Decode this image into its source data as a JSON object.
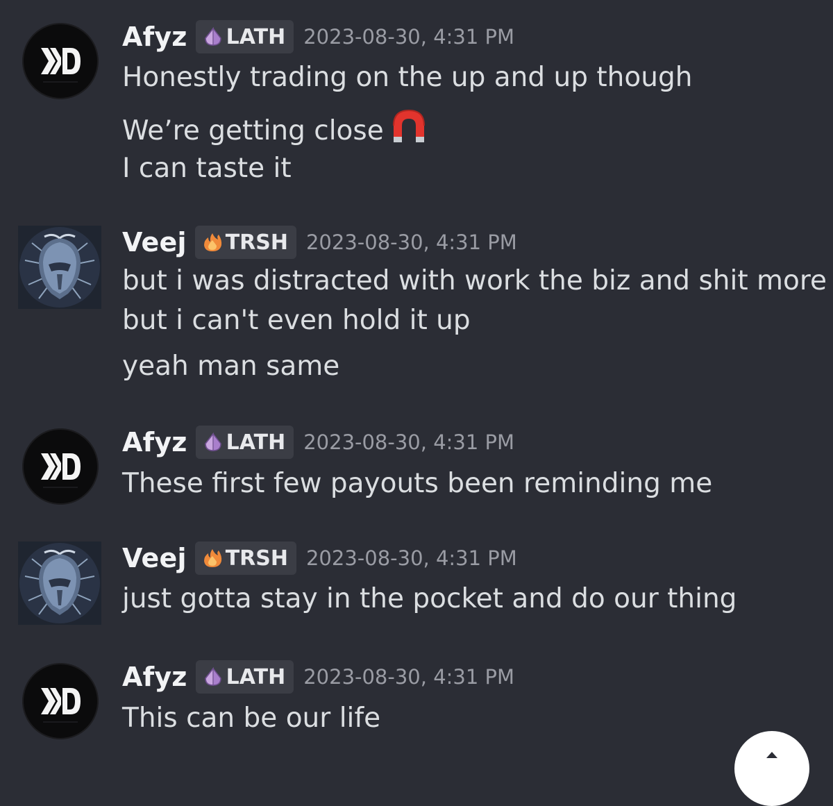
{
  "messages": [
    {
      "author": "Afyz",
      "role_tag": "LATH",
      "role_icon": "crystal-icon",
      "timestamp": "2023-08-30, 4:31 PM",
      "avatar": "xd-logo",
      "lines": [
        "Honestly trading on the up and up though",
        "We’re getting close",
        "I can taste it"
      ],
      "emoji_line_2": "magnet-emoji"
    },
    {
      "author": "Veej",
      "role_tag": "TRSH",
      "role_icon": "fire-icon",
      "timestamp": "2023-08-30, 4:31 PM",
      "avatar": "predator-helmet",
      "lines": [
        "but i was distracted with work the biz and shit more",
        "but i can't even hold it up",
        "yeah man same"
      ]
    },
    {
      "author": "Afyz",
      "role_tag": "LATH",
      "role_icon": "crystal-icon",
      "timestamp": "2023-08-30, 4:31 PM",
      "avatar": "xd-logo",
      "lines": [
        "These first few payouts been reminding me"
      ]
    },
    {
      "author": "Veej",
      "role_tag": "TRSH",
      "role_icon": "fire-icon",
      "timestamp": "2023-08-30, 4:31 PM",
      "avatar": "predator-helmet",
      "lines": [
        "just gotta stay in the pocket and do our thing"
      ]
    },
    {
      "author": "Afyz",
      "role_tag": "LATH",
      "role_icon": "crystal-icon",
      "timestamp": "2023-08-30, 4:31 PM",
      "avatar": "xd-logo",
      "lines": [
        "This can be our life"
      ]
    }
  ],
  "colors": {
    "background": "#2b2d35",
    "username": "#f2f3f5",
    "timestamp": "#9a9ca4",
    "tag_bg": "#3b3d45",
    "lath_icon": "#c9a6e0",
    "trsh_icon": "#f08a3a"
  },
  "scroll_button": {
    "icon": "chevron-up-icon"
  }
}
